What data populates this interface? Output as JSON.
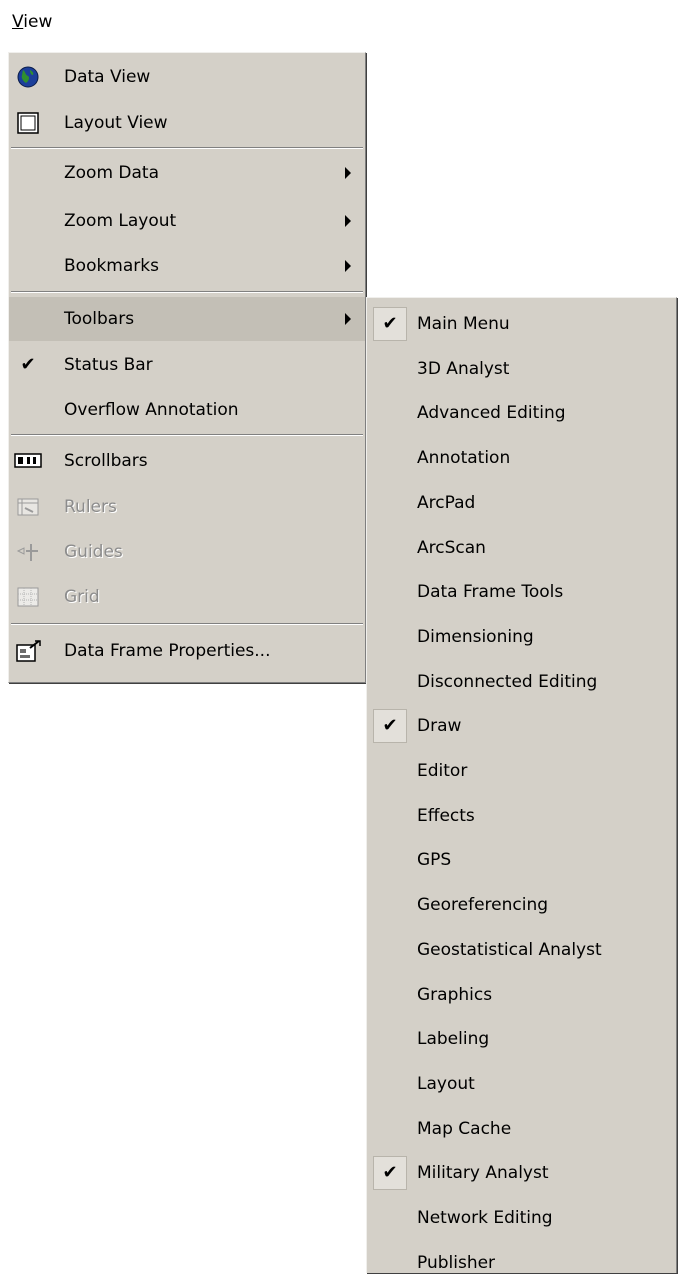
{
  "menubar": {
    "view_label": "View"
  },
  "view_menu": {
    "data_view": "Data View",
    "layout_view": "Layout View",
    "zoom_data": "Zoom Data",
    "zoom_layout": "Zoom Layout",
    "bookmarks": "Bookmarks",
    "toolbars": "Toolbars",
    "status_bar": "Status Bar",
    "overflow_annotation": "Overflow Annotation",
    "scrollbars": "Scrollbars",
    "rulers": "Rulers",
    "guides": "Guides",
    "grid": "Grid",
    "data_frame_properties": "Data Frame Properties..."
  },
  "toolbars_menu": {
    "items": [
      {
        "label": "Main Menu",
        "checked": true
      },
      {
        "label": "3D Analyst",
        "checked": false
      },
      {
        "label": "Advanced Editing",
        "checked": false
      },
      {
        "label": "Annotation",
        "checked": false
      },
      {
        "label": "ArcPad",
        "checked": false
      },
      {
        "label": "ArcScan",
        "checked": false
      },
      {
        "label": "Data Frame Tools",
        "checked": false
      },
      {
        "label": "Dimensioning",
        "checked": false
      },
      {
        "label": "Disconnected Editing",
        "checked": false
      },
      {
        "label": "Draw",
        "checked": true
      },
      {
        "label": "Editor",
        "checked": false
      },
      {
        "label": "Effects",
        "checked": false
      },
      {
        "label": "GPS",
        "checked": false
      },
      {
        "label": "Georeferencing",
        "checked": false
      },
      {
        "label": "Geostatistical Analyst",
        "checked": false
      },
      {
        "label": "Graphics",
        "checked": false
      },
      {
        "label": "Labeling",
        "checked": false
      },
      {
        "label": "Layout",
        "checked": false
      },
      {
        "label": "Map Cache",
        "checked": false
      },
      {
        "label": "Military Analyst",
        "checked": true
      },
      {
        "label": "Network Editing",
        "checked": false
      },
      {
        "label": "Publisher",
        "checked": false
      }
    ]
  },
  "checkmark_glyph": "✔",
  "colors": {
    "menu_bg": "#d4d0c8",
    "highlight": "#c3bfb6",
    "disabled_text": "#8c8c8c"
  }
}
